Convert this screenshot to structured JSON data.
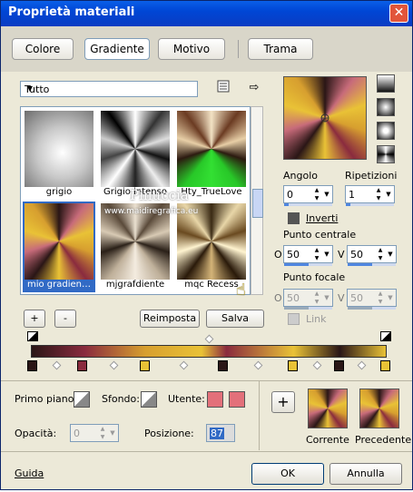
{
  "window": {
    "title": "Proprietà materiali",
    "close": "✕"
  },
  "tabs": [
    {
      "label": "Colore"
    },
    {
      "label": "Gradiente"
    },
    {
      "label": "Motivo"
    },
    {
      "label": "Trama"
    }
  ],
  "filter": {
    "value": "Tutto"
  },
  "gallery": {
    "items": [
      {
        "label": "grigio"
      },
      {
        "label": "Grigio intenso"
      },
      {
        "label": "Hty_TrueLove"
      },
      {
        "label": "mio gradien…"
      },
      {
        "label": "mjgrafdiente"
      },
      {
        "label": "mqc Recess"
      }
    ]
  },
  "watermark": {
    "name": "Pinuccia",
    "url": "www.maidiregrafica.eu"
  },
  "buttons": {
    "add": "+",
    "remove": "-",
    "reset": "Reimposta",
    "save": "Salva"
  },
  "props": {
    "angle_label": "Angolo",
    "angle_value": "0",
    "repeat_label": "Ripetizioni",
    "repeat_value": "1",
    "invert_label": "Inverti",
    "center_label": "Punto centrale",
    "center_h": "50",
    "center_v": "50",
    "focal_label": "Punto focale",
    "focal_h": "50",
    "focal_v": "50",
    "link_label": "Link",
    "h_label": "O",
    "v_label": "V"
  },
  "bottom": {
    "fg_label": "Primo piano:",
    "bg_label": "Sfondo:",
    "user_label": "Utente:",
    "opacity_label": "Opacità:",
    "opacity_value": "0",
    "position_label": "Posizione:",
    "position_value": "87",
    "add_symbol": "+",
    "current_label": "Corrente",
    "previous_label": "Precedente"
  },
  "footer": {
    "help": "Guida",
    "ok": "OK",
    "cancel": "Annulla"
  },
  "colors": {
    "dark": "#2a1616",
    "maroon": "#8a2b3e",
    "rose": "#c76b7a",
    "gold": "#e9c236",
    "amber": "#d79f2f",
    "pink": "#e3707a"
  }
}
